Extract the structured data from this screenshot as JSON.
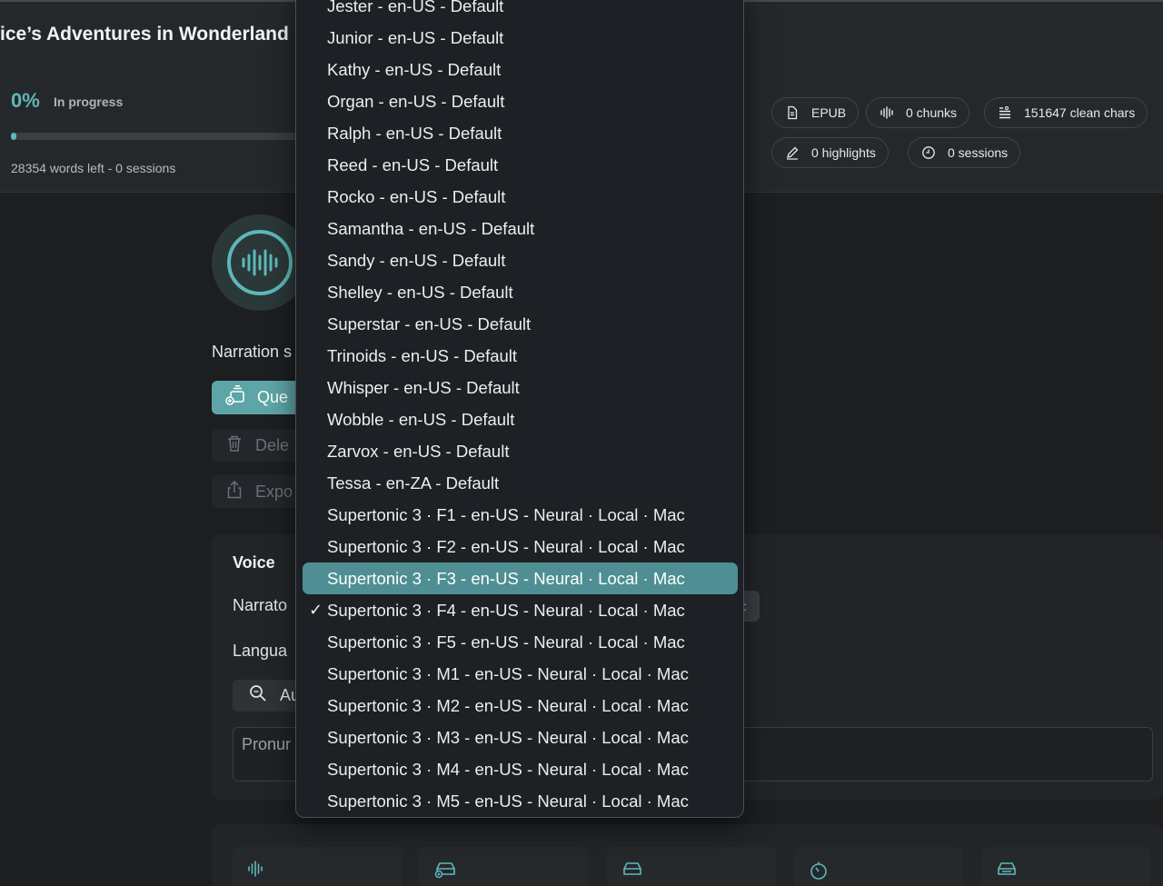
{
  "book": {
    "title": "ice’s Adventures in Wonderland"
  },
  "progress": {
    "percent_label": "0%",
    "percent": 0.01,
    "status": "In progress",
    "words_left": "28354 words left - 0 sessions"
  },
  "stats": {
    "format": "EPUB",
    "chunks": "0 chunks",
    "clean_chars": "151647 clean chars",
    "highlights": "0 highlights",
    "sessions": "0 sessions"
  },
  "narration": {
    "label": "Narration s",
    "queue_label": "Que",
    "delete_label": "Dele",
    "export_label": "Expo"
  },
  "voice": {
    "title": "Voice",
    "narrator_label": "Narrato",
    "narrator_selector_glyph": ":",
    "language_label": "Langua",
    "auto_label": "Au",
    "pronunciation_placeholder": "Pronur"
  },
  "menu": {
    "items": [
      {
        "label": "Jester - en-US - Default",
        "checked": false,
        "highlighted": false
      },
      {
        "label": "Junior - en-US - Default",
        "checked": false,
        "highlighted": false
      },
      {
        "label": "Kathy - en-US - Default",
        "checked": false,
        "highlighted": false
      },
      {
        "label": "Organ - en-US - Default",
        "checked": false,
        "highlighted": false
      },
      {
        "label": "Ralph - en-US - Default",
        "checked": false,
        "highlighted": false
      },
      {
        "label": "Reed - en-US - Default",
        "checked": false,
        "highlighted": false
      },
      {
        "label": "Rocko - en-US - Default",
        "checked": false,
        "highlighted": false
      },
      {
        "label": "Samantha - en-US - Default",
        "checked": false,
        "highlighted": false
      },
      {
        "label": "Sandy - en-US - Default",
        "checked": false,
        "highlighted": false
      },
      {
        "label": "Shelley - en-US - Default",
        "checked": false,
        "highlighted": false
      },
      {
        "label": "Superstar - en-US - Default",
        "checked": false,
        "highlighted": false
      },
      {
        "label": "Trinoids - en-US - Default",
        "checked": false,
        "highlighted": false
      },
      {
        "label": "Whisper - en-US - Default",
        "checked": false,
        "highlighted": false
      },
      {
        "label": "Wobble - en-US - Default",
        "checked": false,
        "highlighted": false
      },
      {
        "label": "Zarvox - en-US - Default",
        "checked": false,
        "highlighted": false
      },
      {
        "label": "Tessa - en-ZA - Default",
        "checked": false,
        "highlighted": false
      },
      {
        "label": "Supertonic 3 · F1 - en-US - Neural · Local · Mac",
        "checked": false,
        "highlighted": false
      },
      {
        "label": "Supertonic 3 · F2 - en-US - Neural · Local · Mac",
        "checked": false,
        "highlighted": false
      },
      {
        "label": "Supertonic 3 · F3 - en-US - Neural · Local · Mac",
        "checked": false,
        "highlighted": true
      },
      {
        "label": "Supertonic 3 · F4 - en-US - Neural · Local · Mac",
        "checked": true,
        "highlighted": false
      },
      {
        "label": "Supertonic 3 · F5 - en-US - Neural · Local · Mac",
        "checked": false,
        "highlighted": false
      },
      {
        "label": "Supertonic 3 · M1 - en-US - Neural · Local · Mac",
        "checked": false,
        "highlighted": false
      },
      {
        "label": "Supertonic 3 · M2 - en-US - Neural · Local · Mac",
        "checked": false,
        "highlighted": false
      },
      {
        "label": "Supertonic 3 · M3 - en-US - Neural · Local · Mac",
        "checked": false,
        "highlighted": false
      },
      {
        "label": "Supertonic 3 · M4 - en-US - Neural · Local · Mac",
        "checked": false,
        "highlighted": false
      },
      {
        "label": "Supertonic 3 · M5 - en-US - Neural · Local · Mac",
        "checked": false,
        "highlighted": false
      }
    ],
    "check_glyph": "✓"
  },
  "colors": {
    "accent": "#5eb8b8",
    "highlight": "#4f8f93",
    "background": "#1c1e20"
  },
  "icons": [
    "document-icon",
    "waveform-icon",
    "text-lines-icon",
    "pencil-icon",
    "clock-icon",
    "queue-icon",
    "trash-icon",
    "share-icon",
    "search-icon",
    "car-icon",
    "drive-icon",
    "timer-icon"
  ]
}
